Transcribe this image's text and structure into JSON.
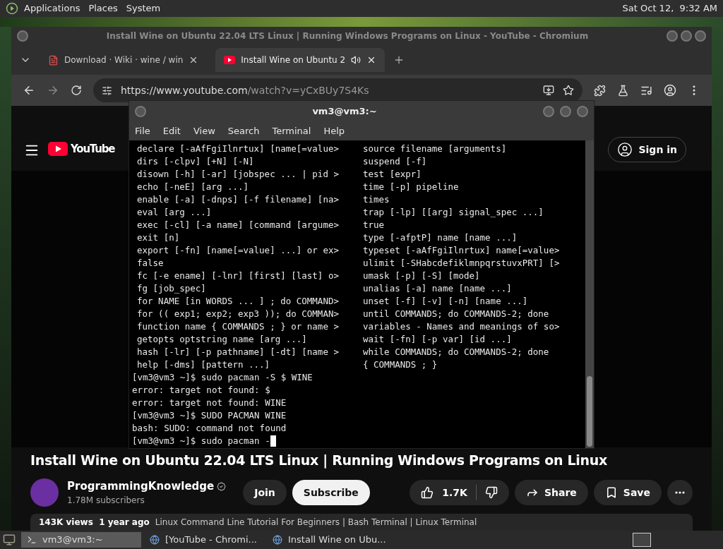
{
  "top_panel": {
    "menus": [
      "Applications",
      "Places",
      "System"
    ],
    "clock": "Sat Oct 12,  9:32 AM"
  },
  "browser": {
    "window_title": "Install Wine on Ubuntu 22.04 LTS Linux | Running Windows Programs on Linux - YouTube - Chromium",
    "tabs": [
      {
        "title": "Download · Wiki · wine / win",
        "selected": false,
        "kind": "wiki"
      },
      {
        "title": "Install Wine on Ubuntu 2",
        "selected": true,
        "kind": "video"
      }
    ],
    "url": {
      "host": "https://www.youtube.com",
      "path": "/watch?v=yCxBUy7S4Ks"
    },
    "youtube": {
      "logo": "YouTube",
      "sign_in": "Sign in",
      "video_title": "Install Wine on Ubuntu 22.04 LTS Linux | Running Windows Programs on Linux",
      "channel": "ProgrammingKnowledge",
      "subscribers": "1.78M subscribers",
      "join": "Join",
      "subscribe": "Subscribe",
      "likes": "1.7K",
      "share": "Share",
      "save": "Save",
      "stats": "143K views  1 year ago",
      "tags": "Linux Command Line Tutorial For Beginners | Bash Terminal | Linux Terminal"
    }
  },
  "terminal": {
    "title": "vm3@vm3:~",
    "menu": [
      "File",
      "Edit",
      "View",
      "Search",
      "Terminal",
      "Help"
    ],
    "help_left": [
      "declare [-aAfFgiIlnrtux] [name[=value>",
      "dirs [-clpv] [+N] [-N]",
      "disown [-h] [-ar] [jobspec ... | pid >",
      "echo [-neE] [arg ...]",
      "enable [-a] [-dnps] [-f filename] [na>",
      "eval [arg ...]",
      "exec [-cl] [-a name] [command [argume>",
      "exit [n]",
      "export [-fn] [name[=value] ...] or ex>",
      "false",
      "fc [-e ename] [-lnr] [first] [last] o>",
      "fg [job_spec]",
      "for NAME [in WORDS ... ] ; do COMMAND>",
      "for (( exp1; exp2; exp3 )); do COMMAN>",
      "function name { COMMANDS ; } or name >",
      "getopts optstring name [arg ...]",
      "hash [-lr] [-p pathname] [-dt] [name >",
      "help [-dms] [pattern ...]"
    ],
    "help_right": [
      "source filename [arguments]",
      "suspend [-f]",
      "test [expr]",
      "time [-p] pipeline",
      "times",
      "trap [-lp] [[arg] signal_spec ...]",
      "true",
      "type [-afptP] name [name ...]",
      "typeset [-aAfFgiIlnrtux] name[=value>",
      "ulimit [-SHabcdefiklmnpqrstuvxPRT] [>",
      "umask [-p] [-S] [mode]",
      "unalias [-a] name [name ...]",
      "unset [-f] [-v] [-n] [name ...]",
      "until COMMANDS; do COMMANDS-2; done",
      "variables - Names and meanings of so>",
      "wait [-fn] [-p var] [id ...]",
      "while COMMANDS; do COMMANDS-2; done",
      "{ COMMANDS ; }"
    ],
    "output": [
      "[vm3@vm3 ~]$ sudo pacman -S $ WINE",
      "error: target not found: $",
      "error: target not found: WINE",
      "[vm3@vm3 ~]$ SUDO PACMAN WINE",
      "bash: SUDO: command not found",
      "[vm3@vm3 ~]$ sudo pacman -"
    ]
  },
  "taskbar": [
    {
      "label": "vm3@vm3:~",
      "selected": true,
      "kind": "terminal"
    },
    {
      "label": "[YouTube - Chromi...",
      "selected": false,
      "kind": "browser"
    },
    {
      "label": "Install Wine on Ubu...",
      "selected": false,
      "kind": "browser"
    }
  ]
}
